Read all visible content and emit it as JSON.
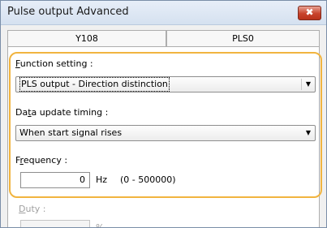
{
  "window": {
    "title": "Pulse output Advanced",
    "close_glyph": "✖"
  },
  "tabs": [
    {
      "label": "Y108"
    },
    {
      "label": "PLS0"
    }
  ],
  "function_setting": {
    "label_accel": "F",
    "label_rest": "unction setting :",
    "value": "PLS output - Direction distinction",
    "arrow": "▼"
  },
  "data_update_timing": {
    "label_pre": "Da",
    "label_accel": "t",
    "label_rest": "a update timing :",
    "value": "When start signal rises",
    "arrow": "▼"
  },
  "frequency": {
    "label_pre": "F",
    "label_accel": "r",
    "label_rest": "equency :",
    "value": "0",
    "unit": "Hz",
    "range": "(0 - 500000)"
  },
  "duty": {
    "label_accel": "D",
    "label_rest": "uty :",
    "unit": "%"
  },
  "colors": {
    "highlight": "#f1b43f",
    "close_button": "#c8432c"
  }
}
